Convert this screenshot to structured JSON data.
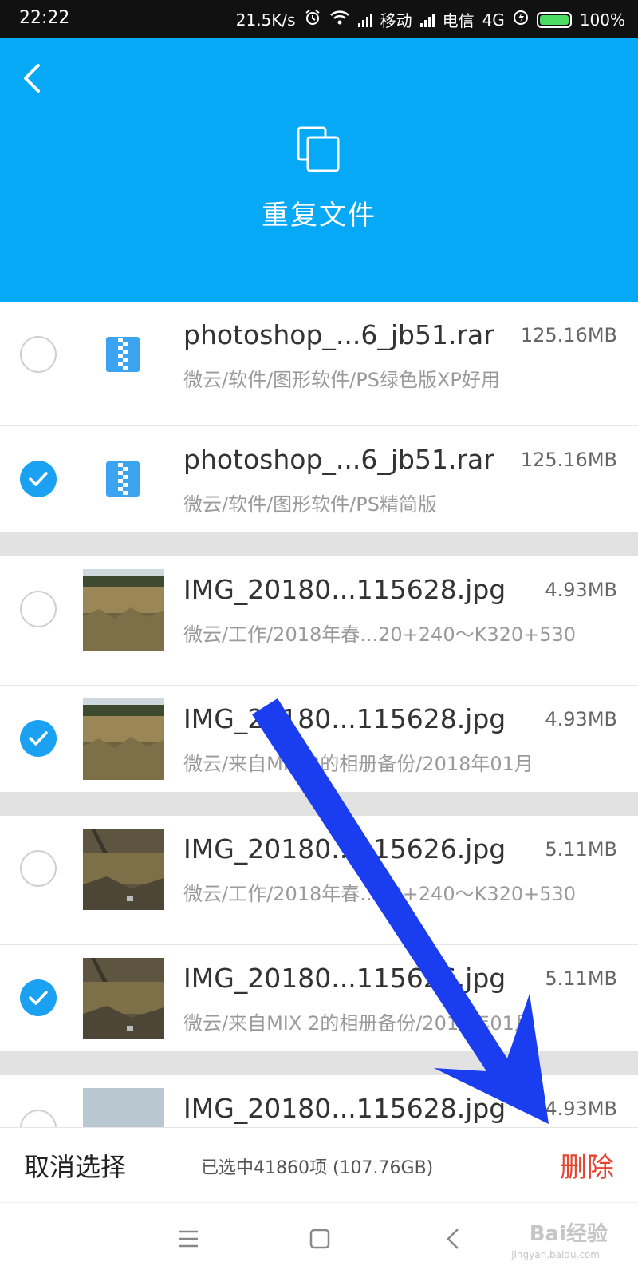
{
  "status_bar": {
    "time": "22:22",
    "speed": "21.5K/s",
    "carrier1": "移动",
    "carrier2": "电信",
    "network": "4G",
    "battery": "100%"
  },
  "header": {
    "title": "重复文件",
    "icon": "duplicate-files-icon",
    "color": "#05A9F6"
  },
  "files": [
    {
      "name": "photoshop_...6_jb51.rar",
      "size": "125.16MB",
      "path": "微云/软件/图形软件/PS绿色版XP好用",
      "checked": false,
      "type": "zip"
    },
    {
      "name": "photoshop_...6_jb51.rar",
      "size": "125.16MB",
      "path": "微云/软件/图形软件/PS精简版",
      "checked": true,
      "type": "zip"
    },
    {
      "name": "IMG_20180...115628.jpg",
      "size": "4.93MB",
      "path": "微云/工作/2018年春...20+240～K320+530",
      "checked": false,
      "type": "image"
    },
    {
      "name": "IMG_20180...115628.jpg",
      "size": "4.93MB",
      "path": "微云/来自MIX 2的相册备份/2018年01月",
      "checked": true,
      "type": "image"
    },
    {
      "name": "IMG_20180...115626.jpg",
      "size": "5.11MB",
      "path": "微云/工作/2018年春...20+240～K320+530",
      "checked": false,
      "type": "image"
    },
    {
      "name": "IMG_20180...115626.jpg",
      "size": "5.11MB",
      "path": "微云/来自MIX 2的相册备份/2018年01月",
      "checked": true,
      "type": "image"
    },
    {
      "name": "IMG_20180...115628.jpg",
      "size": "4.93MB",
      "path": "",
      "checked": false,
      "type": "image"
    }
  ],
  "action_bar": {
    "cancel_label": "取消选择",
    "selected_info": "已选中41860项 (107.76GB)",
    "delete_label": "删除",
    "delete_color": "#E8432E"
  },
  "nav_bar": {
    "watermark": "Bai经验",
    "watermark_sub": "jingyan.baidu.com"
  }
}
